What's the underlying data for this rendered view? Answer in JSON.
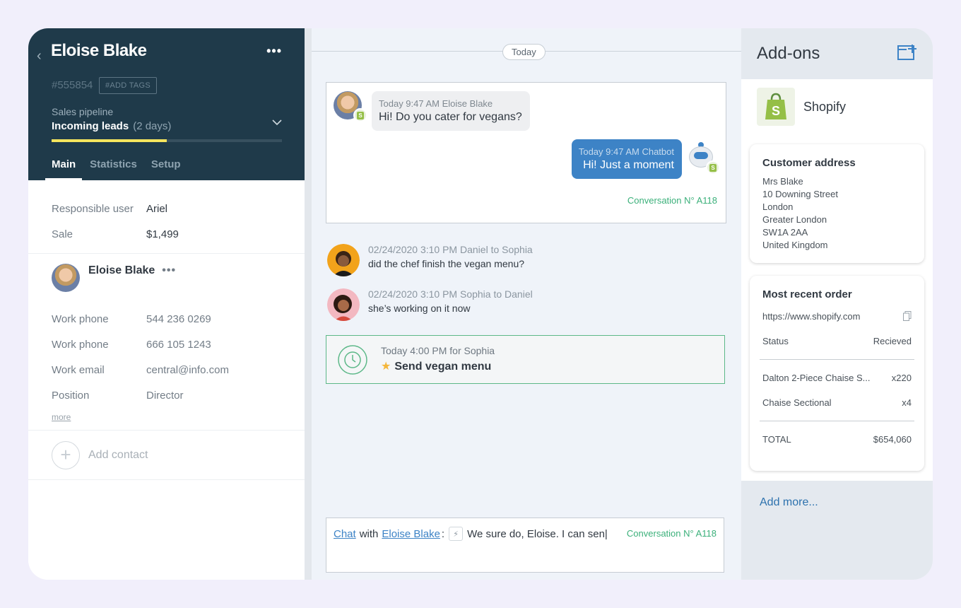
{
  "lead": {
    "name": "Eloise Blake",
    "id": "#555854",
    "add_tags": "#ADD TAGS",
    "pipeline_label": "Sales pipeline",
    "stage": "Incoming leads",
    "stage_duration": "(2 days)",
    "stage_progress": 0.5,
    "tabs": [
      "Main",
      "Statistics",
      "Setup"
    ],
    "active_tab": "Main",
    "fields": [
      {
        "label": "Responsible user",
        "value": "Ariel"
      },
      {
        "label": "Sale",
        "value": "$1,499"
      }
    ],
    "contact": {
      "name": "Eloise Blake",
      "fields": [
        {
          "label": "Work phone",
          "value": "544 236 0269"
        },
        {
          "label": "Work phone",
          "value": "666 105 1243"
        },
        {
          "label": "Work email",
          "value": "central@info.com"
        },
        {
          "label": "Position",
          "value": "Director"
        }
      ],
      "more": "more"
    },
    "add_contact": "Add contact"
  },
  "chat": {
    "day_label": "Today",
    "incoming": {
      "meta": "Today 9:47 AM Eloise Blake",
      "text": "Hi! Do you cater for vegans?"
    },
    "outgoing": {
      "meta": "Today 9:47 AM Chatbot",
      "text": "Hi! Just a moment"
    },
    "conversation": "Conversation N° A118",
    "thread": [
      {
        "meta": "02/24/2020 3:10 PM Daniel to Sophia",
        "text": "did the chef finish the vegan menu?"
      },
      {
        "meta": "02/24/2020 3:10 PM Sophia to Daniel",
        "text": "she’s working on it now"
      }
    ],
    "task": {
      "meta": "Today 4:00 PM for Sophia",
      "title": "Send vegan menu"
    },
    "composer": {
      "channel": "Chat",
      "with_label": "with",
      "recipient": "Eloise Blake",
      "colon": ":",
      "text": "We sure do, Eloise. I can sen|",
      "conversation": "Conversation N° A118"
    }
  },
  "addons": {
    "title": "Add-ons",
    "shop_name": "Shopify",
    "address": {
      "title": "Customer address",
      "lines": [
        "Mrs Blake",
        "10 Downing Street",
        "London",
        "Greater London",
        "SW1A 2AA",
        "United Kingdom"
      ]
    },
    "order": {
      "title": "Most recent order",
      "url": "https://www.shopify.com",
      "status_label": "Status",
      "status_value": "Recieved",
      "items": [
        {
          "name": "Dalton 2-Piece Chaise S...",
          "qty": "x220"
        },
        {
          "name": "Chaise Sectional",
          "qty": "x4"
        }
      ],
      "total_label": "TOTAL",
      "total_value": "$654,060"
    },
    "add_more": "Add more..."
  },
  "colors": {
    "header_bg": "#1f3a4a",
    "progress": "#f5e55d",
    "accent_blue": "#3d83c6",
    "accent_green": "#3bb07a",
    "shopify_green": "#95bf47"
  },
  "icons": [
    "back-chevron-icon",
    "more-dots-icon",
    "chevron-down-icon",
    "plus-icon",
    "shopify-icon",
    "robot-icon",
    "clock-icon",
    "star-icon",
    "bolt-icon",
    "copy-icon",
    "add-panel-icon"
  ]
}
